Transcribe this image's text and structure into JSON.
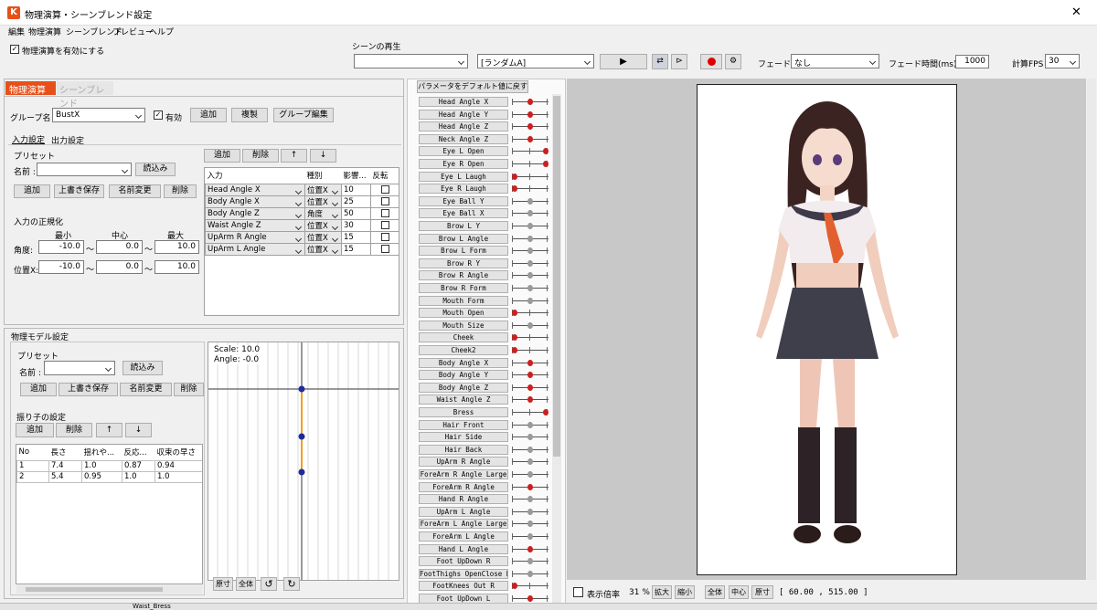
{
  "window": {
    "title": "物理演算・シーンブレンド設定",
    "close_glyph": "✕"
  },
  "menu": [
    "編集",
    "物理演算",
    "シーンブレンド",
    "プレビュー",
    "ヘルプ"
  ],
  "physics_enable": {
    "label": "物理演算を有効にする",
    "checked": true
  },
  "scene": {
    "section_label": "シーンの再生",
    "scene_select_value": "",
    "random_select_value": "[ランダムA]",
    "fade_label": "フェード :",
    "fade_value": "なし",
    "fade_time_label": "フェード時間(ms) :",
    "fade_time_value": "1000",
    "fps_label": "計算FPS",
    "fps_value": "30"
  },
  "tabs": {
    "physics": "物理演算",
    "scene_blend": "シーンブレンド"
  },
  "group": {
    "name_label": "グループ名 :",
    "name_value": "BustX",
    "enabled_label": "有効",
    "add_label": "追加",
    "duplicate_label": "複製",
    "edit_label": "グループ編集"
  },
  "subtabs": {
    "input": "入力設定",
    "output": "出力設定"
  },
  "preset": {
    "section_label": "プリセット",
    "name_label": "名前 :",
    "load_label": "読込み",
    "add_label": "追加",
    "overwrite_label": "上書き保存",
    "rename_label": "名前変更",
    "delete_label": "削除"
  },
  "normalize": {
    "title": "入力の正規化",
    "min_label": "最小",
    "center_label": "中心",
    "max_label": "最大",
    "rows": [
      {
        "label": "角度:",
        "min": "-10.0",
        "center": "0.0",
        "max": "10.0"
      },
      {
        "label": "位置X:",
        "min": "-10.0",
        "center": "0.0",
        "max": "10.0"
      }
    ],
    "tilde": "～"
  },
  "input_table": {
    "add_label": "追加",
    "delete_label": "削除",
    "up_glyph": "↑",
    "down_glyph": "↓",
    "headers": [
      "入力",
      "種別",
      "影響...",
      "反転"
    ],
    "rows": [
      {
        "input": "Head Angle X",
        "type": "位置X",
        "weight": "10"
      },
      {
        "input": "Body Angle X",
        "type": "位置X",
        "weight": "25"
      },
      {
        "input": "Body Angle Z",
        "type": "角度",
        "weight": "50"
      },
      {
        "input": "Waist Angle Z",
        "type": "位置X",
        "weight": "30"
      },
      {
        "input": "UpArm R Angle",
        "type": "位置X",
        "weight": "15"
      },
      {
        "input": "UpArm L Angle",
        "type": "位置X",
        "weight": "15"
      }
    ]
  },
  "model": {
    "title": "物理モデル設定",
    "preset_label": "プリセット",
    "name_label": "名前 :",
    "load_label": "読込み",
    "add_label": "追加",
    "overwrite_label": "上書き保存",
    "rename_label": "名前変更",
    "delete_label": "削除",
    "pendulum_label": "振り子の設定",
    "pend_add_label": "追加",
    "pend_delete_label": "削除",
    "up_glyph": "↑",
    "down_glyph": "↓",
    "headers": [
      "No",
      "長さ",
      "揺れや...",
      "反応...",
      "収束の早さ"
    ],
    "rows": [
      [
        "1",
        "7.4",
        "1.0",
        "0.87",
        "0.94"
      ],
      [
        "2",
        "5.4",
        "0.95",
        "1.0",
        "1.0"
      ]
    ]
  },
  "pendulum_view": {
    "scale_text": "Scale: 10.0",
    "angle_text": "Angle: -0.0",
    "actual_size_label": "原寸",
    "fit_label": "全体",
    "rotate_left_glyph": "↺",
    "rotate_right_glyph": "↻"
  },
  "params": {
    "reset_label": "パラメータをデフォルト値に戻す",
    "items": [
      {
        "name": "Head Angle X",
        "pos": 0.5
      },
      {
        "name": "Head Angle Y",
        "pos": 0.5
      },
      {
        "name": "Head Angle Z",
        "pos": 0.5
      },
      {
        "name": "Neck Angle Z",
        "pos": 0.5
      },
      {
        "name": "Eye L Open",
        "pos": 1.0
      },
      {
        "name": "Eye R Open",
        "pos": 1.0
      },
      {
        "name": "Eye L Laugh",
        "pos": 0.0
      },
      {
        "name": "Eye R Laugh",
        "pos": 0.0
      },
      {
        "name": "Eye Ball Y",
        "pos": 0.5
      },
      {
        "name": "Eye Ball X",
        "pos": 0.5
      },
      {
        "name": "Brow L Y",
        "pos": 0.5
      },
      {
        "name": "Brow L Angle",
        "pos": 0.5
      },
      {
        "name": "Brow L Form",
        "pos": 0.5
      },
      {
        "name": "Brow R Y",
        "pos": 0.5
      },
      {
        "name": "Brow R Angle",
        "pos": 0.5
      },
      {
        "name": "Brow R Form",
        "pos": 0.5
      },
      {
        "name": "Mouth Form",
        "pos": 0.5
      },
      {
        "name": "Mouth Open",
        "pos": 0.0
      },
      {
        "name": "Mouth Size",
        "pos": 0.5
      },
      {
        "name": "Cheek",
        "pos": 0.0
      },
      {
        "name": "Cheek2",
        "pos": 0.0
      },
      {
        "name": "Body Angle X",
        "pos": 0.5
      },
      {
        "name": "Body Angle Y",
        "pos": 0.5
      },
      {
        "name": "Body Angle Z",
        "pos": 0.5
      },
      {
        "name": "Waist Angle Z",
        "pos": 0.5
      },
      {
        "name": "Bress",
        "pos": 1.0
      },
      {
        "name": "Hair Front",
        "pos": 0.5
      },
      {
        "name": "Hair Side",
        "pos": 0.5
      },
      {
        "name": "Hair Back",
        "pos": 0.5
      },
      {
        "name": "UpArm R Angle",
        "pos": 0.5
      },
      {
        "name": "ForeArm R Angle Large",
        "pos": 0.5
      },
      {
        "name": "ForeArm R Angle",
        "pos": 0.5
      },
      {
        "name": "Hand R Angle",
        "pos": 0.5
      },
      {
        "name": "UpArm L Angle",
        "pos": 0.5
      },
      {
        "name": "ForeArm L Angle Large",
        "pos": 0.5
      },
      {
        "name": "ForeArm L Angle",
        "pos": 0.5
      },
      {
        "name": "Hand L Angle",
        "pos": 0.5
      },
      {
        "name": "Foot UpDown R",
        "pos": 0.5
      },
      {
        "name": "FootThighs OpenClose R",
        "pos": 0.5
      },
      {
        "name": "FootKnees Out R",
        "pos": 0.0
      },
      {
        "name": "Foot UpDown L",
        "pos": 0.5
      }
    ]
  },
  "preview_bar": {
    "zoom_label": "表示倍率",
    "zoom_value": "31 %",
    "zoom_in_label": "拡大",
    "zoom_out_label": "縮小",
    "fit_label": "全体",
    "center_label": "中心",
    "actual_label": "原寸",
    "coords": "[  60.00 , 515.00 ]"
  },
  "taskbar_text": "Waist_Bress",
  "colors": {
    "tab_active": "#e8501a",
    "record": "#e00000",
    "knob_red": "#cc1f1f",
    "knob_gray": "#9a9a9a",
    "preview_bg": "#c8c8c8"
  }
}
